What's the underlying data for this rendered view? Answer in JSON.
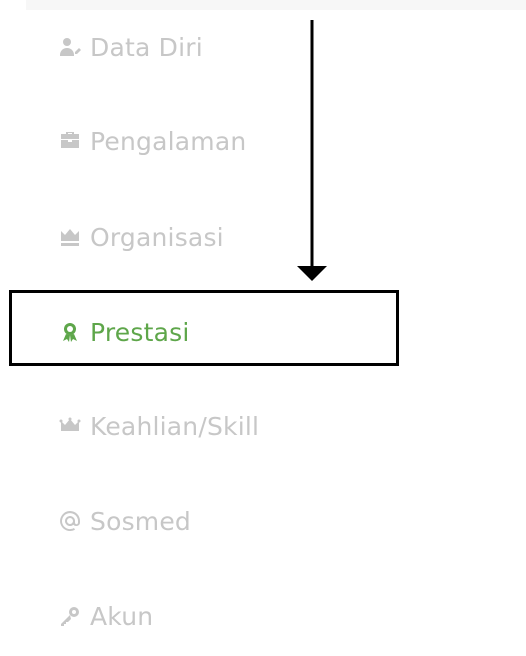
{
  "sidebar": {
    "items": [
      {
        "label": "Data Diri",
        "icon": "user-edit-icon",
        "active": false
      },
      {
        "label": "Pengalaman",
        "icon": "briefcase-icon",
        "active": false
      },
      {
        "label": "Organisasi",
        "icon": "crown-icon",
        "active": false
      },
      {
        "label": "Prestasi",
        "icon": "award-icon",
        "active": true
      },
      {
        "label": "Keahlian/Skill",
        "icon": "crown-icon",
        "active": false
      },
      {
        "label": "Sosmed",
        "icon": "at-sign-icon",
        "active": false
      },
      {
        "label": "Akun",
        "icon": "key-icon",
        "active": false
      }
    ]
  },
  "colors": {
    "inactive_text": "#c7c7c7",
    "active_text": "#5ea64a",
    "highlight_border": "#000000",
    "arrow": "#000000"
  }
}
